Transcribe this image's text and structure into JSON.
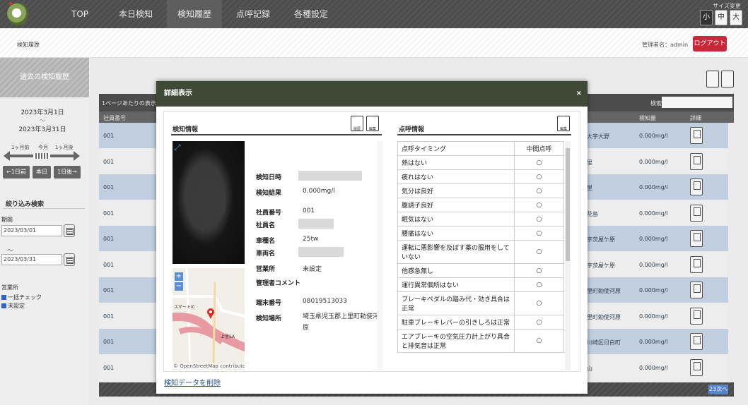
{
  "nav": {
    "items": [
      "TOP",
      "本日検知",
      "検知履歴",
      "点呼記録",
      "各種設定"
    ],
    "active_index": 2,
    "size_label": "サイズ変更",
    "size_options": [
      "小",
      "中",
      "大"
    ]
  },
  "subheader": {
    "breadcrumb": "検知履歴",
    "admin_label": "管理者名：admin",
    "logout_label": "ログアウト"
  },
  "sidebar": {
    "title": "過去の検知履歴",
    "date_from": "2023年3月1日",
    "date_sep": "～",
    "date_to": "2023年3月31日",
    "range_labels": [
      "1ヶ月前",
      "今月",
      "1ヶ月後"
    ],
    "day_buttons": [
      "←1日前",
      "本日",
      "1日後→"
    ],
    "filter_title": "絞り込み検索",
    "period_label": "期間",
    "period_from": "2023/03/01",
    "period_sep": "～",
    "period_to": "2023/03/31",
    "office_label": "営業所",
    "checkboxes": [
      "一括チェック",
      "未設定"
    ]
  },
  "table": {
    "per_page_label": "1ページあたりの表示件",
    "search_label": "検索:",
    "col_employee": "社員番号",
    "col_value": "検知量",
    "col_detail": "詳細",
    "rows": [
      {
        "id": "001",
        "place": "大字大野",
        "value": "0.000mg/l"
      },
      {
        "id": "001",
        "place": "里",
        "value": "0.000mg/l"
      },
      {
        "id": "001",
        "place": "里",
        "value": "0.000mg/l"
      },
      {
        "id": "001",
        "place": "花島",
        "value": "0.000mg/l"
      },
      {
        "id": "001",
        "place": "字茨屋ケ原",
        "value": "0.000mg/l"
      },
      {
        "id": "001",
        "place": "字茨屋ケ原",
        "value": "0.000mg/l"
      },
      {
        "id": "001",
        "place": "里町勅使河原",
        "value": "0.000mg/l"
      },
      {
        "id": "001",
        "place": "里町勅使河原",
        "value": "0.000mg/l"
      },
      {
        "id": "001",
        "place": "川崎区日白町",
        "value": "0.000mg/l"
      },
      {
        "id": "001",
        "place": "山",
        "value": "0.000mg/l"
      }
    ],
    "pager_next": "23次へ"
  },
  "modal": {
    "title": "詳細表示",
    "close": "×",
    "detect_section": "検知情報",
    "icon_history": "履歴",
    "icon_edit": "編集",
    "call_section": "点呼情報",
    "icon_edit2": "編集",
    "fields": [
      {
        "label": "検知日時",
        "value": ""
      },
      {
        "label": "検知結果",
        "value": "0.000mg/l"
      },
      {
        "label": "社員番号",
        "value": "001"
      },
      {
        "label": "社員名",
        "value": ""
      },
      {
        "label": "車種名",
        "value": "25tw"
      },
      {
        "label": "車両名",
        "value": ""
      },
      {
        "label": "営業所",
        "value": "未設定"
      },
      {
        "label": "管理者コメント",
        "value": ""
      },
      {
        "label": "端末番号",
        "value": "08019513033"
      },
      {
        "label": "検知場所",
        "value": "埼玉県児玉郡上里町勅使河原"
      }
    ],
    "map_attribution": "© OpenStreetMap contributors",
    "map_label_1": "スマートIC",
    "map_label_2": "上里SA",
    "call_header": {
      "item": "点呼タイミング",
      "value": "中間点呼"
    },
    "call_items": [
      {
        "item": "熱はない",
        "value": "○"
      },
      {
        "item": "疲れはない",
        "value": "○"
      },
      {
        "item": "気分は良好",
        "value": "○"
      },
      {
        "item": "腹調子良好",
        "value": "○"
      },
      {
        "item": "眠気はない",
        "value": "○"
      },
      {
        "item": "腰痛はない",
        "value": "○"
      },
      {
        "item": "運転に悪影響を及ぼす薬の服用をしていない",
        "value": "○"
      },
      {
        "item": "他感急無し",
        "value": "○"
      },
      {
        "item": "運行異常個所はない",
        "value": "○"
      },
      {
        "item": "ブレーキペダルの踏み代・効き具合は正常",
        "value": "○"
      },
      {
        "item": "駐車ブレーキレバーの引きしろは正常",
        "value": "○"
      },
      {
        "item": "エアブレーキの空気圧力計上がり具合と排気音は正常",
        "value": "○"
      }
    ],
    "delete_link": "検知データを削除"
  },
  "colors": {
    "nav_bg": "#4d4d4d",
    "modal_header": "#3f4a36",
    "logout": "#c8283a",
    "row_blue": "#c9d7ea"
  }
}
